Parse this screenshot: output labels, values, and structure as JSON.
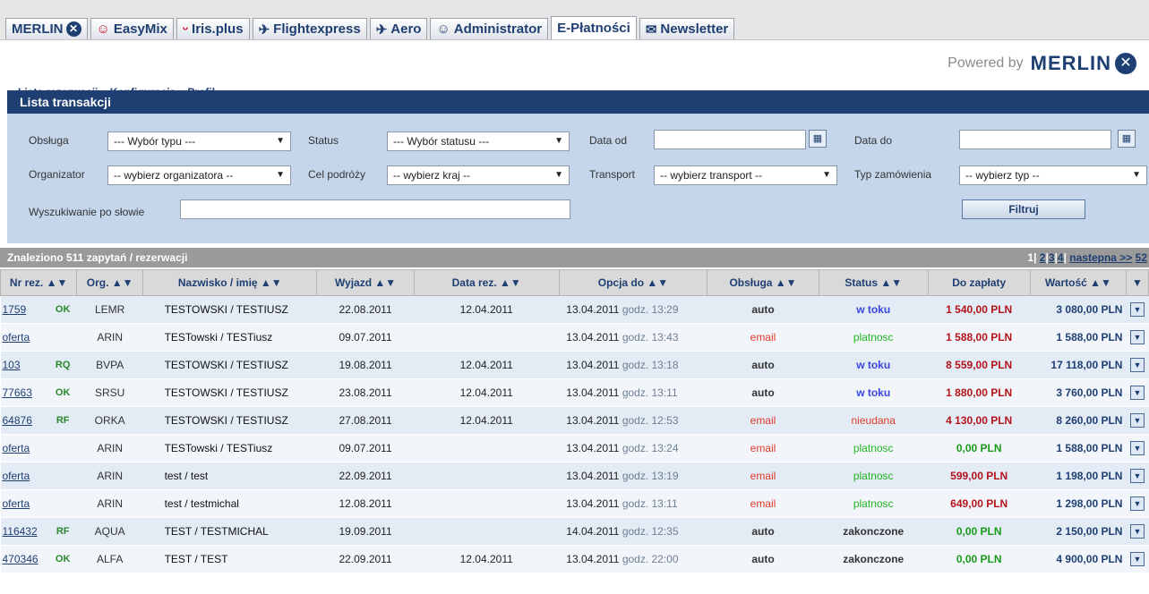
{
  "tabs": [
    {
      "label": "MERLIN",
      "icon": "merlin-logo-icon",
      "active": false
    },
    {
      "label": "EasyMix",
      "icon": "easymix-icon",
      "active": false
    },
    {
      "label": "Iris.plus",
      "icon": "iris-icon",
      "active": false
    },
    {
      "label": "Flightexpress",
      "icon": "plane-icon",
      "active": false
    },
    {
      "label": "Aero",
      "icon": "plane-icon",
      "active": false
    },
    {
      "label": "Administrator",
      "icon": "user-icon",
      "active": false
    },
    {
      "label": "E-Płatności",
      "icon": "",
      "active": true
    },
    {
      "label": "Newsletter",
      "icon": "envelope-icon",
      "active": false
    }
  ],
  "submenu": {
    "reservations": "Lista rezerwacji",
    "config": "Konfiguracja",
    "profile": "Profil"
  },
  "powered": {
    "text": "Powered by",
    "brand": "MERLIN"
  },
  "section_title": "Lista transakcji",
  "filters": {
    "obsluga_label": "Obsługa",
    "obsluga_value": "--- Wybór typu ---",
    "status_label": "Status",
    "status_value": "--- Wybór statusu ---",
    "data_od_label": "Data od",
    "data_do_label": "Data do",
    "organizator_label": "Organizator",
    "organizator_value": "-- wybierz organizatora --",
    "cel_label": "Cel podróży",
    "cel_value": "-- wybierz kraj --",
    "transport_label": "Transport",
    "transport_value": "-- wybierz transport --",
    "typ_label": "Typ zamówienia",
    "typ_value": "-- wybierz typ --",
    "search_label": "Wyszukiwanie po słowie",
    "search_value": "",
    "filter_button": "Filtruj"
  },
  "results": {
    "count_text": "Znaleziono 511 zapytań / rezerwacji",
    "pages": [
      "1",
      "2",
      "3",
      "4"
    ],
    "separator": "|",
    "next": "nastepna >>",
    "last": "52"
  },
  "columns": [
    "Nr rez. ▲▼",
    "Org. ▲▼",
    "Nazwisko / imię ▲▼",
    "Wyjazd ▲▼",
    "Data rez. ▲▼",
    "Opcja do ▲▼",
    "Obsługa ▲▼",
    "Status ▲▼",
    "Do zapłaty",
    "Wartość ▲▼",
    "▼"
  ],
  "rows": [
    {
      "nr": "1759",
      "code": "OK",
      "org": "LEMR",
      "name": "TESTOWSKI / TESTIUSZ",
      "wyjazd": "22.08.2011",
      "datarez": "12.04.2011",
      "opcja_date": "13.04.2011",
      "opcja_godz": "godz. 13:29",
      "obsluga": "auto",
      "status": "w toku",
      "do_zaplaty": "1 540,00 PLN",
      "wartosc": "3 080,00 PLN"
    },
    {
      "nr": "oferta",
      "code": "",
      "org": "ARIN",
      "name": "TESTowski / TESTiusz",
      "wyjazd": "09.07.2011",
      "datarez": "",
      "opcja_date": "13.04.2011",
      "opcja_godz": "godz. 13:43",
      "obsluga": "email",
      "status": "platnosc",
      "do_zaplaty": "1 588,00 PLN",
      "wartosc": "1 588,00 PLN"
    },
    {
      "nr": "103",
      "code": "RQ",
      "org": "BVPA",
      "name": "TESTOWSKI / TESTIUSZ",
      "wyjazd": "19.08.2011",
      "datarez": "12.04.2011",
      "opcja_date": "13.04.2011",
      "opcja_godz": "godz. 13:18",
      "obsluga": "auto",
      "status": "w toku",
      "do_zaplaty": "8 559,00 PLN",
      "wartosc": "17 118,00 PLN"
    },
    {
      "nr": "77663",
      "code": "OK",
      "org": "SRSU",
      "name": "TESTOWSKI / TESTIUSZ",
      "wyjazd": "23.08.2011",
      "datarez": "12.04.2011",
      "opcja_date": "13.04.2011",
      "opcja_godz": "godz. 13:11",
      "obsluga": "auto",
      "status": "w toku",
      "do_zaplaty": "1 880,00 PLN",
      "wartosc": "3 760,00 PLN"
    },
    {
      "nr": "64876",
      "code": "RF",
      "org": "ORKA",
      "name": "TESTOWSKI / TESTIUSZ",
      "wyjazd": "27.08.2011",
      "datarez": "12.04.2011",
      "opcja_date": "13.04.2011",
      "opcja_godz": "godz. 12:53",
      "obsluga": "email",
      "status": "nieudana",
      "do_zaplaty": "4 130,00 PLN",
      "wartosc": "8 260,00 PLN"
    },
    {
      "nr": "oferta",
      "code": "",
      "org": "ARIN",
      "name": "TESTowski / TESTiusz",
      "wyjazd": "09.07.2011",
      "datarez": "",
      "opcja_date": "13.04.2011",
      "opcja_godz": "godz. 13:24",
      "obsluga": "email",
      "status": "platnosc",
      "do_zaplaty": "0,00 PLN",
      "wartosc": "1 588,00 PLN"
    },
    {
      "nr": "oferta",
      "code": "",
      "org": "ARIN",
      "name": "test / test",
      "wyjazd": "22.09.2011",
      "datarez": "",
      "opcja_date": "13.04.2011",
      "opcja_godz": "godz. 13:19",
      "obsluga": "email",
      "status": "platnosc",
      "do_zaplaty": "599,00 PLN",
      "wartosc": "1 198,00 PLN"
    },
    {
      "nr": "oferta",
      "code": "",
      "org": "ARIN",
      "name": "test / testmichal",
      "wyjazd": "12.08.2011",
      "datarez": "",
      "opcja_date": "13.04.2011",
      "opcja_godz": "godz. 13:11",
      "obsluga": "email",
      "status": "platnosc",
      "do_zaplaty": "649,00 PLN",
      "wartosc": "1 298,00 PLN"
    },
    {
      "nr": "116432",
      "code": "RF",
      "org": "AQUA",
      "name": "TEST / TESTMICHAL",
      "wyjazd": "19.09.2011",
      "datarez": "",
      "opcja_date": "14.04.2011",
      "opcja_godz": "godz. 12:35",
      "obsluga": "auto",
      "status": "zakonczone",
      "do_zaplaty": "0,00 PLN",
      "wartosc": "2 150,00 PLN"
    },
    {
      "nr": "470346",
      "code": "OK",
      "org": "ALFA",
      "name": "TEST / TEST",
      "wyjazd": "22.09.2011",
      "datarez": "12.04.2011",
      "opcja_date": "13.04.2011",
      "opcja_godz": "godz. 22:00",
      "obsluga": "auto",
      "status": "zakonczone",
      "do_zaplaty": "0,00 PLN",
      "wartosc": "4 900,00 PLN"
    }
  ],
  "colors": {
    "brand": "#1f3f73",
    "panel": "#c5d6ea",
    "row_odd": "#e3ebf5",
    "row_even": "#f2f6fb",
    "amount_red": "#b3131a",
    "amount_green": "#1a9a1a"
  }
}
